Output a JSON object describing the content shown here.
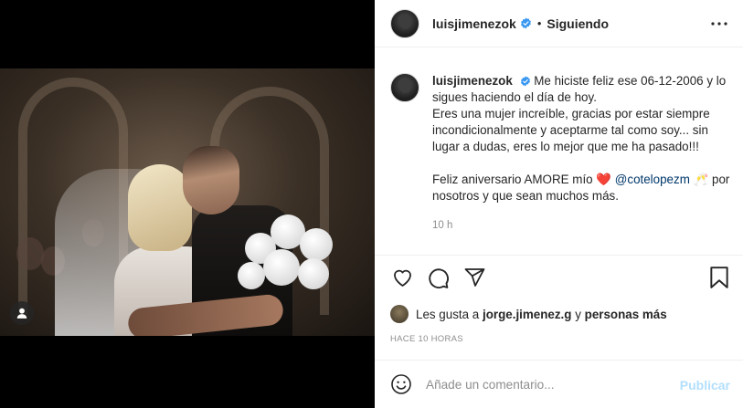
{
  "post": {
    "username": "luisjimenezok",
    "follow_separator": "•",
    "follow_status": "Siguiendo"
  },
  "caption": {
    "username": "luisjimenezok",
    "line1": "Me hiciste feliz ese 06-12-2006 y lo sigues haciendo el día de hoy.",
    "line2": "Eres una mujer increíble, gracias por estar siempre incondicionalmente y aceptarme tal como soy... sin lugar a dudas, eres lo mejor que me ha pasado!!!",
    "line3_pre": "Feliz aniversario AMORE mío",
    "heart": "❤️",
    "mention": "@cotelopezm",
    "toast": "🥂",
    "line3_post": "por nosotros y que sean muchos más.",
    "time": "10 h"
  },
  "likes": {
    "prefix": "Les gusta a",
    "user": "jorge.jimenez.g",
    "connector": "y",
    "others": "personas más"
  },
  "posted_ago": "HACE 10 HORAS",
  "comment": {
    "placeholder": "Añade un comentario...",
    "publish_label": "Publicar"
  },
  "icons": {
    "more": "more-options-icon",
    "like": "heart-icon",
    "comment": "comment-icon",
    "share": "paper-plane-icon",
    "save": "bookmark-icon",
    "emoji": "emoji-icon",
    "verified": "verified-badge-icon",
    "user_tag": "user-tag-icon"
  },
  "colors": {
    "verified": "#3897f0",
    "mention": "#00376b",
    "heart": "#ed4956",
    "publish_disabled": "#b2dffc",
    "muted": "#8e8e8e"
  }
}
